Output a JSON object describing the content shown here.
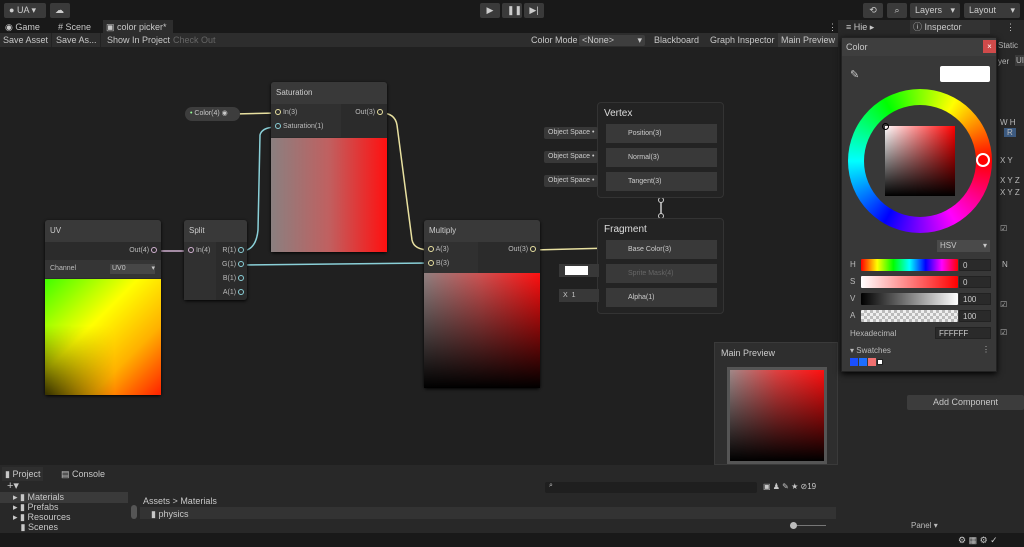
{
  "topbar": {
    "account": "UA",
    "layers": "Layers",
    "layout": "Layout"
  },
  "tabs": [
    {
      "label": "Game"
    },
    {
      "label": "Scene"
    },
    {
      "label": "color picker*"
    }
  ],
  "toolbar": {
    "save_asset": "Save Asset",
    "save_as": "Save As...",
    "show_in_project": "Show In Project",
    "check_out": "Check Out",
    "color_mode_label": "Color Mode",
    "color_mode_value": "<None>",
    "blackboard": "Blackboard",
    "graph_inspector": "Graph Inspector",
    "main_preview": "Main Preview"
  },
  "nodes": {
    "color_prop": "Color(4)",
    "saturation": {
      "title": "Saturation",
      "in": "In(3)",
      "sat": "Saturation(1)",
      "out": "Out(3)"
    },
    "uv": {
      "title": "UV",
      "out": "Out(4)",
      "channel_label": "Channel",
      "channel_value": "UV0"
    },
    "split": {
      "title": "Split",
      "in": "In(4)",
      "r": "R(1)",
      "g": "G(1)",
      "b": "B(1)",
      "a": "A(1)"
    },
    "multiply": {
      "title": "Multiply",
      "a": "A(3)",
      "b": "B(3)",
      "out": "Out(3)"
    },
    "vertex": {
      "title": "Vertex",
      "position": "Position(3)",
      "normal": "Normal(3)",
      "tangent": "Tangent(3)",
      "space": "Object Space"
    },
    "fragment": {
      "title": "Fragment",
      "base_color": "Base Color(3)",
      "sprite_mask": "Sprite Mask(4)",
      "alpha": "Alpha(1)",
      "alpha_axis": "X",
      "alpha_value": "1"
    },
    "main_preview": "Main Preview"
  },
  "right_tabs": {
    "hierarchy": "Hie",
    "inspector": "Inspector"
  },
  "inspector": {
    "static": "Static",
    "layer": "yer",
    "layer_val": "UI",
    "add_component": "Add Component",
    "panel": "Panel",
    "wh": "W H",
    "r": "R",
    "xy": "X Y",
    "xyz": "X Y Z",
    "n": "N"
  },
  "color_picker": {
    "title": "Color",
    "mode": "HSV",
    "h": "0",
    "s": "0",
    "v": "100",
    "a": "100",
    "hex_label": "Hexadecimal",
    "hex": "FFFFFF",
    "swatches_label": "Swatches",
    "h_label": "H",
    "s_label": "S",
    "v_label": "V",
    "a_label": "A",
    "swatch_colors": [
      "#1a4fff",
      "#1e6fff",
      "#f07070",
      "#ffffff"
    ]
  },
  "project": {
    "tab_project": "Project",
    "tab_console": "Console",
    "folders": [
      "Materials",
      "Prefabs",
      "Resources",
      "Scenes"
    ],
    "breadcrumb_root": "Assets",
    "breadcrumb_sep": ">",
    "breadcrumb_current": "Materials",
    "items": [
      "physics"
    ],
    "hidden_count": "19"
  }
}
